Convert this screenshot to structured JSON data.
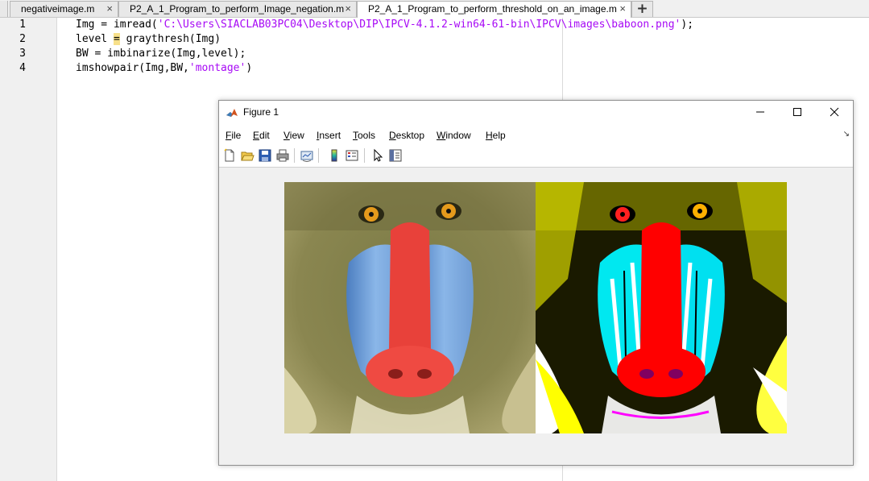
{
  "tabs": [
    {
      "label": "negativeimage.m"
    },
    {
      "label": "P2_A_1_Program_to_perform_Image_negation.m"
    },
    {
      "label": "P2_A_1_Program_to_perform_threshold_on_an_image.m"
    }
  ],
  "tab_close_glyph": "×",
  "tab_add_glyph": "+",
  "editor": {
    "line_numbers": [
      "1",
      "2",
      "3",
      "4"
    ],
    "lines": [
      {
        "pre": "Img = imread(",
        "str": "'C:\\Users\\SIACLAB03PC04\\Desktop\\DIP\\IPCV-4.1.2-win64-61-bin\\IPCV\\images\\baboon.png'",
        "post": ");"
      },
      {
        "pre": "level ",
        "hl": "=",
        "post": " graythresh(Img)"
      },
      {
        "pre": "BW = imbinarize(Img,level);"
      },
      {
        "pre": "imshowpair(Img,BW,",
        "str": "'montage'",
        "post": ")"
      }
    ]
  },
  "figure": {
    "title": "Figure 1",
    "menus": [
      {
        "key": "F",
        "rest": "ile"
      },
      {
        "key": "E",
        "rest": "dit"
      },
      {
        "key": "V",
        "rest": "iew"
      },
      {
        "key": "I",
        "rest": "nsert"
      },
      {
        "key": "T",
        "rest": "ools"
      },
      {
        "key": "D",
        "rest": "esktop"
      },
      {
        "key": "W",
        "rest": "indow"
      },
      {
        "key": "H",
        "rest": "elp"
      }
    ],
    "toolbar_icons": [
      "new-figure-icon",
      "open-file-icon",
      "save-icon",
      "print-icon",
      "link-plot-icon",
      "colorbar-icon",
      "legend-icon",
      "edit-plot-icon",
      "property-inspector-icon"
    ]
  },
  "colors": {
    "string": "#a709f5",
    "highlight": "#f7e08a"
  }
}
